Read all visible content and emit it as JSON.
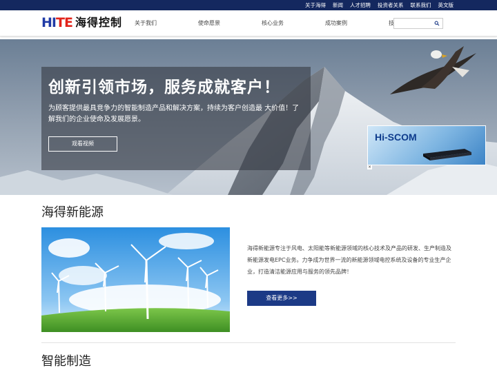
{
  "topbar": {
    "links": [
      "关于海得",
      "新闻",
      "人才招聘",
      "投资者关系",
      "联系我们",
      "英文版"
    ]
  },
  "header": {
    "logo_mark_part1": "HI",
    "logo_mark_part2": "TE",
    "logo_text": "海得控制",
    "nav": [
      "关于我们",
      "使命愿景",
      "核心业务",
      "成功案例",
      "技术创新"
    ],
    "search_placeholder": ""
  },
  "hero": {
    "title": "创新引领市场，服务成就客户！",
    "description": "为顾客提供最具竞争力的智能制造产品和解决方案，持续为客户创造最 大价值！了解我们的企业使命及发展愿景。",
    "video_button": "观看视频",
    "ad_text": "Hi-SCOM",
    "ad_close": "×"
  },
  "energy": {
    "title": "海得新能源",
    "description": "海得新能源专注于风电、太阳能等新能源领域的核心技术及产品的研发、生产制造及新能源发电EPC业务。力争成为世界一流的新能源领域电控系统及设备的专业生产企业，打造清洁能源应用与服务的领先品牌！",
    "more_button": "查看更多>>"
  },
  "manufacturing": {
    "title": "智能制造"
  },
  "colors": {
    "topbar": "#14285f",
    "button": "#1c3a86",
    "logo_blue": "#1f3aa6",
    "logo_red": "#e2231a"
  },
  "icons": {
    "search": "search-icon",
    "close": "close-icon"
  }
}
